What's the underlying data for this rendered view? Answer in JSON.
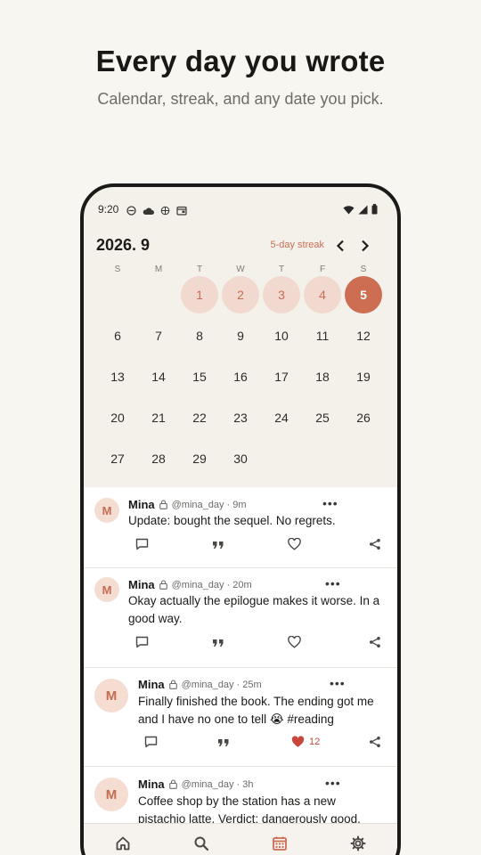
{
  "hero": {
    "title": "Every day you wrote",
    "subtitle": "Calendar, streak, and any date you pick."
  },
  "status_bar": {
    "time": "9:20",
    "left_icons": [
      "app-notification-icon",
      "cloud-icon",
      "globe-icon",
      "calendar-notification-icon"
    ],
    "right_icons": [
      "wifi-icon",
      "signal-icon",
      "battery-icon"
    ]
  },
  "calendar": {
    "month_label": "2026. 9",
    "streak_label": "5-day streak",
    "weekdays": [
      "S",
      "M",
      "T",
      "W",
      "T",
      "F",
      "S"
    ],
    "first_weekday_index": 2,
    "days_in_month": 30,
    "written_days": [
      1,
      2,
      3,
      4
    ],
    "today": 5,
    "accent_color": "#cd6e53",
    "written_color": "#f2d9cf"
  },
  "feed": {
    "posts": [
      {
        "avatar_letter": "M",
        "name": "Mina",
        "handle_time": "@mina_day · 9m",
        "text": "Update: bought the sequel. No regrets.",
        "liked": false,
        "like_count": ""
      },
      {
        "avatar_letter": "M",
        "name": "Mina",
        "handle_time": "@mina_day · 20m",
        "text": "Okay actually the epilogue makes it worse. In a good way.",
        "liked": false,
        "like_count": ""
      },
      {
        "avatar_letter": "M",
        "name": "Mina",
        "handle_time": "@mina_day · 25m",
        "text": "Finally finished the book. The ending got me and I have no one to tell 😭 #reading",
        "liked": true,
        "like_count": "12"
      },
      {
        "avatar_letter": "M",
        "name": "Mina",
        "handle_time": "@mina_day · 3h",
        "text": "Coffee shop by the station has a new pistachio latte. Verdict: dangerously good.",
        "liked": false,
        "like_count": ""
      }
    ]
  },
  "tab_bar": {
    "tabs": [
      "home-icon",
      "search-icon",
      "calendar-icon",
      "settings-icon"
    ],
    "active_index": 2
  }
}
